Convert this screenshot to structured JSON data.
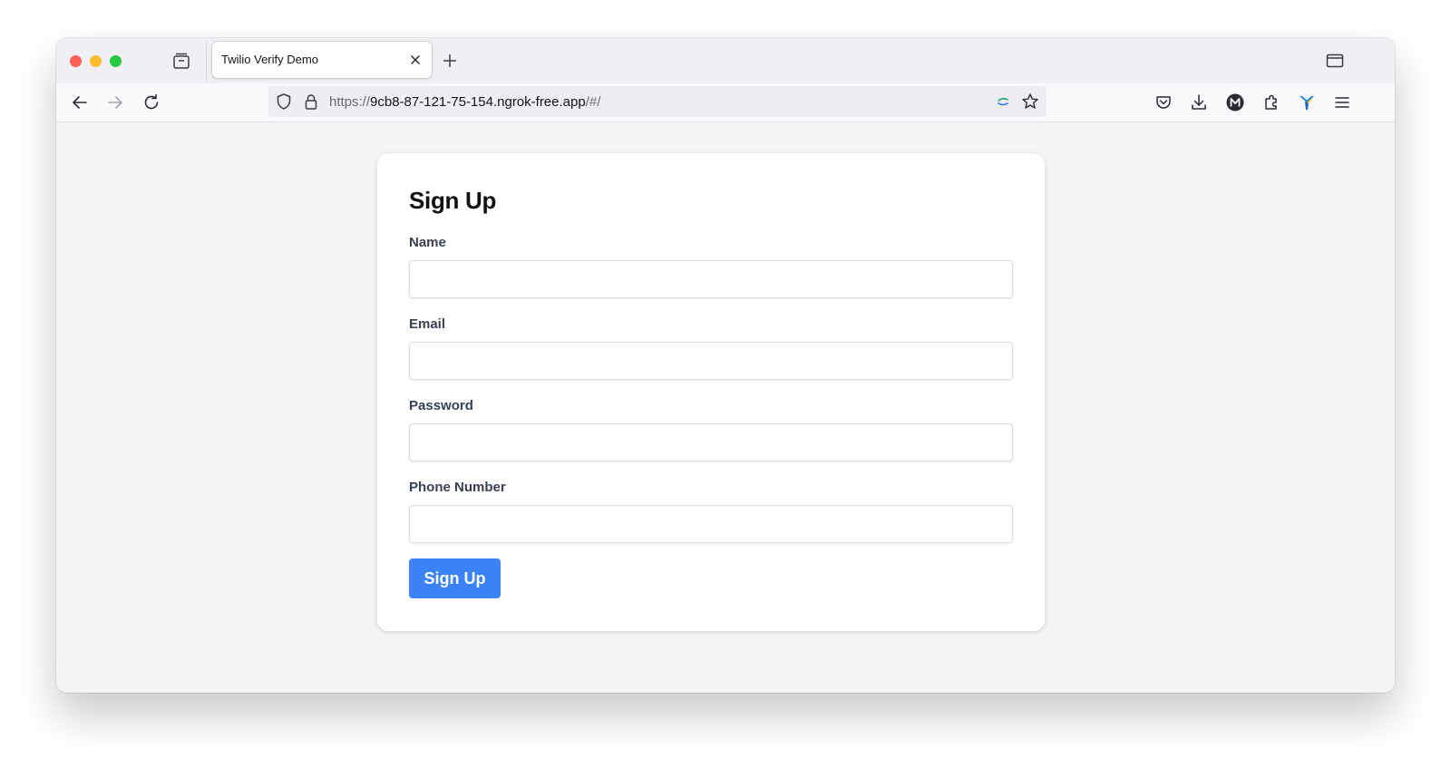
{
  "browser": {
    "tab": {
      "title": "Twilio Verify Demo"
    },
    "url": {
      "scheme": "https://",
      "host": "9cb8-87-121-75-154.ngrok-free.app",
      "path": "/#/"
    }
  },
  "page": {
    "heading": "Sign Up",
    "fields": [
      {
        "label": "Name",
        "value": ""
      },
      {
        "label": "Email",
        "value": ""
      },
      {
        "label": "Password",
        "value": ""
      },
      {
        "label": "Phone Number",
        "value": ""
      }
    ],
    "submit_label": "Sign Up"
  },
  "colors": {
    "primary_button": "#3b82f6",
    "page_background": "#f3f4f6",
    "card_background": "#ffffff"
  },
  "icons": [
    "tab-manager-icon",
    "close-icon",
    "plus-icon",
    "tab-list-icon",
    "back-arrow-icon",
    "forward-arrow-icon",
    "reload-icon",
    "shield-icon",
    "lock-icon",
    "translate-icon",
    "star-icon",
    "pocket-icon",
    "download-icon",
    "account-icon",
    "extensions-icon",
    "extension-icon",
    "menu-icon"
  ]
}
